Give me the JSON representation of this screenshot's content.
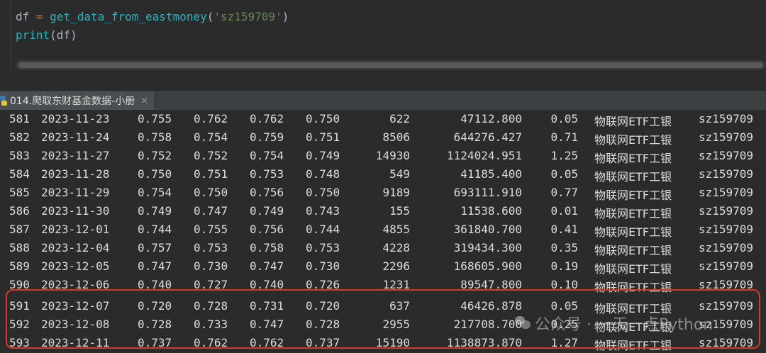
{
  "editor": {
    "line1": {
      "var": "df",
      "op": " = ",
      "fn": "get_data_from_eastmoney",
      "arg": "'sz159709'"
    },
    "line2": {
      "fn": "print",
      "args": "(df)"
    }
  },
  "tab": {
    "label": "014.爬取东财基金数据-小册",
    "close": "×"
  },
  "rows": [
    [
      "581",
      "2023-11-23",
      "0.755",
      "0.762",
      "0.762",
      "0.750",
      "622",
      "47112.800",
      "0.05",
      "物联网ETF工银",
      "sz159709"
    ],
    [
      "582",
      "2023-11-24",
      "0.758",
      "0.754",
      "0.759",
      "0.751",
      "8506",
      "644276.427",
      "0.71",
      "物联网ETF工银",
      "sz159709"
    ],
    [
      "583",
      "2023-11-27",
      "0.752",
      "0.752",
      "0.754",
      "0.749",
      "14930",
      "1124024.951",
      "1.25",
      "物联网ETF工银",
      "sz159709"
    ],
    [
      "584",
      "2023-11-28",
      "0.750",
      "0.751",
      "0.753",
      "0.748",
      "549",
      "41185.400",
      "0.05",
      "物联网ETF工银",
      "sz159709"
    ],
    [
      "585",
      "2023-11-29",
      "0.754",
      "0.750",
      "0.756",
      "0.750",
      "9189",
      "693111.910",
      "0.77",
      "物联网ETF工银",
      "sz159709"
    ],
    [
      "586",
      "2023-11-30",
      "0.749",
      "0.747",
      "0.749",
      "0.743",
      "155",
      "11538.600",
      "0.01",
      "物联网ETF工银",
      "sz159709"
    ],
    [
      "587",
      "2023-12-01",
      "0.744",
      "0.755",
      "0.756",
      "0.744",
      "4855",
      "361840.700",
      "0.41",
      "物联网ETF工银",
      "sz159709"
    ],
    [
      "588",
      "2023-12-04",
      "0.757",
      "0.753",
      "0.758",
      "0.753",
      "4228",
      "319434.300",
      "0.35",
      "物联网ETF工银",
      "sz159709"
    ],
    [
      "589",
      "2023-12-05",
      "0.747",
      "0.730",
      "0.747",
      "0.730",
      "2296",
      "168605.900",
      "0.19",
      "物联网ETF工银",
      "sz159709"
    ],
    [
      "590",
      "2023-12-06",
      "0.740",
      "0.727",
      "0.740",
      "0.726",
      "1231",
      "89547.800",
      "0.10",
      "物联网ETF工银",
      "sz159709"
    ],
    [
      "591",
      "2023-12-07",
      "0.720",
      "0.728",
      "0.731",
      "0.720",
      "637",
      "46426.878",
      "0.05",
      "物联网ETF工银",
      "sz159709"
    ],
    [
      "592",
      "2023-12-08",
      "0.728",
      "0.733",
      "0.747",
      "0.728",
      "2955",
      "217708.700",
      "0.25",
      "物联网ETF工银",
      "sz159709"
    ],
    [
      "593",
      "2023-12-11",
      "0.737",
      "0.762",
      "0.762",
      "0.737",
      "15190",
      "1138873.870",
      "1.27",
      "物联网ETF工银",
      "sz159709"
    ]
  ],
  "watermark": {
    "text": "公众号 · 一天一点Python"
  }
}
